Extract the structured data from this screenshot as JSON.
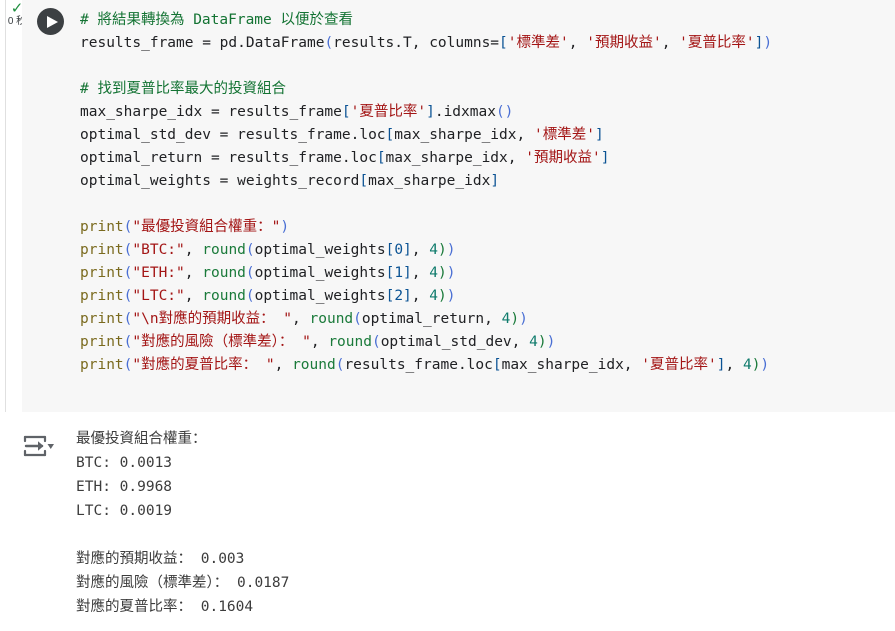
{
  "cell": {
    "run_status_icon": "check-icon",
    "elapsed_label": "0 秒",
    "run_button_icon": "play-icon",
    "output_icon": "output-toggle-icon"
  },
  "code": {
    "lines": [
      {
        "id": "l1",
        "tokens": [
          {
            "c": "t-com",
            "t": "# 將結果轉換為 DataFrame 以便於查看"
          }
        ]
      },
      {
        "id": "l2",
        "tokens": [
          {
            "c": "t-plain",
            "t": "results_frame = pd.DataFrame"
          },
          {
            "c": "t-par",
            "t": "("
          },
          {
            "c": "t-plain",
            "t": "results.T, columns="
          },
          {
            "c": "t-brk",
            "t": "["
          },
          {
            "c": "t-str",
            "t": "'標準差'"
          },
          {
            "c": "t-plain",
            "t": ", "
          },
          {
            "c": "t-str",
            "t": "'預期收益'"
          },
          {
            "c": "t-plain",
            "t": ", "
          },
          {
            "c": "t-str",
            "t": "'夏普比率'"
          },
          {
            "c": "t-brk",
            "t": "]"
          },
          {
            "c": "t-par",
            "t": ")"
          }
        ]
      },
      {
        "id": "l3",
        "tokens": []
      },
      {
        "id": "l4",
        "tokens": [
          {
            "c": "t-com",
            "t": "# 找到夏普比率最大的投資組合"
          }
        ]
      },
      {
        "id": "l5",
        "tokens": [
          {
            "c": "t-plain",
            "t": "max_sharpe_idx = results_frame"
          },
          {
            "c": "t-brk",
            "t": "["
          },
          {
            "c": "t-str",
            "t": "'夏普比率'"
          },
          {
            "c": "t-brk",
            "t": "]"
          },
          {
            "c": "t-plain",
            "t": ".idxmax"
          },
          {
            "c": "t-par",
            "t": "()"
          }
        ]
      },
      {
        "id": "l6",
        "tokens": [
          {
            "c": "t-plain",
            "t": "optimal_std_dev = results_frame.loc"
          },
          {
            "c": "t-brk",
            "t": "["
          },
          {
            "c": "t-plain",
            "t": "max_sharpe_idx, "
          },
          {
            "c": "t-str",
            "t": "'標準差'"
          },
          {
            "c": "t-brk",
            "t": "]"
          }
        ]
      },
      {
        "id": "l7",
        "tokens": [
          {
            "c": "t-plain",
            "t": "optimal_return = results_frame.loc"
          },
          {
            "c": "t-brk",
            "t": "["
          },
          {
            "c": "t-plain",
            "t": "max_sharpe_idx, "
          },
          {
            "c": "t-str",
            "t": "'預期收益'"
          },
          {
            "c": "t-brk",
            "t": "]"
          }
        ]
      },
      {
        "id": "l8",
        "tokens": [
          {
            "c": "t-plain",
            "t": "optimal_weights = weights_record"
          },
          {
            "c": "t-brk",
            "t": "["
          },
          {
            "c": "t-plain",
            "t": "max_sharpe_idx"
          },
          {
            "c": "t-brk",
            "t": "]"
          }
        ]
      },
      {
        "id": "l9",
        "tokens": []
      },
      {
        "id": "l10",
        "tokens": [
          {
            "c": "t-fn",
            "t": "print"
          },
          {
            "c": "t-par",
            "t": "("
          },
          {
            "c": "t-str",
            "t": "\"最優投資組合權重："
          },
          {
            "c": "t-str",
            "t": "\""
          },
          {
            "c": "t-par",
            "t": ")"
          }
        ]
      },
      {
        "id": "l11",
        "tokens": [
          {
            "c": "t-fn",
            "t": "print"
          },
          {
            "c": "t-par",
            "t": "("
          },
          {
            "c": "t-str",
            "t": "\"BTC:\""
          },
          {
            "c": "t-plain",
            "t": ", "
          },
          {
            "c": "t-bi",
            "t": "round"
          },
          {
            "c": "t-par",
            "t": "("
          },
          {
            "c": "t-plain",
            "t": "optimal_weights"
          },
          {
            "c": "t-brk",
            "t": "[0]"
          },
          {
            "c": "t-plain",
            "t": ", "
          },
          {
            "c": "t-num",
            "t": "4"
          },
          {
            "c": "t-bi",
            "t": ")"
          },
          {
            "c": "t-par",
            "t": ")"
          }
        ]
      },
      {
        "id": "l12",
        "tokens": [
          {
            "c": "t-fn",
            "t": "print"
          },
          {
            "c": "t-par",
            "t": "("
          },
          {
            "c": "t-str",
            "t": "\"ETH:\""
          },
          {
            "c": "t-plain",
            "t": ", "
          },
          {
            "c": "t-bi",
            "t": "round"
          },
          {
            "c": "t-par",
            "t": "("
          },
          {
            "c": "t-plain",
            "t": "optimal_weights"
          },
          {
            "c": "t-brk",
            "t": "[1]"
          },
          {
            "c": "t-plain",
            "t": ", "
          },
          {
            "c": "t-num",
            "t": "4"
          },
          {
            "c": "t-bi",
            "t": ")"
          },
          {
            "c": "t-par",
            "t": ")"
          }
        ]
      },
      {
        "id": "l13",
        "tokens": [
          {
            "c": "t-fn",
            "t": "print"
          },
          {
            "c": "t-par",
            "t": "("
          },
          {
            "c": "t-str",
            "t": "\"LTC:\""
          },
          {
            "c": "t-plain",
            "t": ", "
          },
          {
            "c": "t-bi",
            "t": "round"
          },
          {
            "c": "t-par",
            "t": "("
          },
          {
            "c": "t-plain",
            "t": "optimal_weights"
          },
          {
            "c": "t-brk",
            "t": "[2]"
          },
          {
            "c": "t-plain",
            "t": ", "
          },
          {
            "c": "t-num",
            "t": "4"
          },
          {
            "c": "t-bi",
            "t": ")"
          },
          {
            "c": "t-par",
            "t": ")"
          }
        ]
      },
      {
        "id": "l14",
        "tokens": [
          {
            "c": "t-fn",
            "t": "print"
          },
          {
            "c": "t-par",
            "t": "("
          },
          {
            "c": "t-str",
            "t": "\"\\n對應的預期收益： \""
          },
          {
            "c": "t-plain",
            "t": ", "
          },
          {
            "c": "t-bi",
            "t": "round"
          },
          {
            "c": "t-par",
            "t": "("
          },
          {
            "c": "t-plain",
            "t": "optimal_return, "
          },
          {
            "c": "t-num",
            "t": "4"
          },
          {
            "c": "t-bi",
            "t": ")"
          },
          {
            "c": "t-par",
            "t": ")"
          }
        ]
      },
      {
        "id": "l15",
        "tokens": [
          {
            "c": "t-fn",
            "t": "print"
          },
          {
            "c": "t-par",
            "t": "("
          },
          {
            "c": "t-str",
            "t": "\"對應的風險（標準差）： \""
          },
          {
            "c": "t-plain",
            "t": ", "
          },
          {
            "c": "t-bi",
            "t": "round"
          },
          {
            "c": "t-par",
            "t": "("
          },
          {
            "c": "t-plain",
            "t": "optimal_std_dev, "
          },
          {
            "c": "t-num",
            "t": "4"
          },
          {
            "c": "t-bi",
            "t": ")"
          },
          {
            "c": "t-par",
            "t": ")"
          }
        ]
      },
      {
        "id": "l16",
        "tokens": [
          {
            "c": "t-fn",
            "t": "print"
          },
          {
            "c": "t-par",
            "t": "("
          },
          {
            "c": "t-str",
            "t": "\"對應的夏普比率： \""
          },
          {
            "c": "t-plain",
            "t": ", "
          },
          {
            "c": "t-bi",
            "t": "round"
          },
          {
            "c": "t-par",
            "t": "("
          },
          {
            "c": "t-plain",
            "t": "results_frame.loc"
          },
          {
            "c": "t-brk",
            "t": "["
          },
          {
            "c": "t-plain",
            "t": "max_sharpe_idx, "
          },
          {
            "c": "t-str",
            "t": "'夏普比率'"
          },
          {
            "c": "t-brk",
            "t": "]"
          },
          {
            "c": "t-plain",
            "t": ", "
          },
          {
            "c": "t-num",
            "t": "4"
          },
          {
            "c": "t-bi",
            "t": ")"
          },
          {
            "c": "t-par",
            "t": ")"
          }
        ]
      }
    ]
  },
  "output": {
    "lines": [
      "最優投資組合權重：",
      "BTC: 0.0013",
      "ETH: 0.9968",
      "LTC: 0.0019",
      "",
      "對應的預期收益： 0.003",
      "對應的風險（標準差）： 0.0187",
      "對應的夏普比率： 0.1604"
    ]
  },
  "colors": {
    "cell_background": "#f7f7f7",
    "comment": "#137333",
    "string": "#a31515",
    "builtin_print": "#7a6a1e",
    "builtin_round": "#1a7a3a",
    "bracket": "#0b5394",
    "paren": "#4a6fd4",
    "number": "#0f7b6c",
    "status_check": "#1e8e3e",
    "run_button": "#3c4043",
    "output_text": "#3c3c3c"
  }
}
